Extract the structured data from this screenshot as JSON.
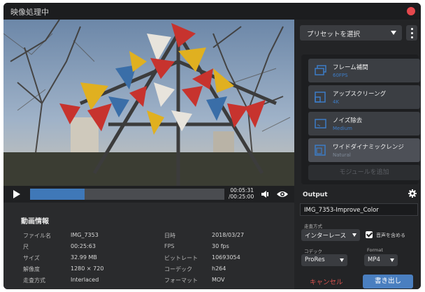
{
  "window": {
    "title": "映像処理中"
  },
  "player": {
    "progress": 0.28,
    "time_current": "00:05:31",
    "time_total": "/00:25:00"
  },
  "info": {
    "title": "動画情報",
    "rows_left": [
      {
        "label": "ファイル名",
        "value": "IMG_7353"
      },
      {
        "label": "尺",
        "value": "00:25:63"
      },
      {
        "label": "サイズ",
        "value": "32.99 MB"
      },
      {
        "label": "解像度",
        "value": "1280 × 720"
      },
      {
        "label": "走査方式",
        "value": "Interlaced"
      }
    ],
    "rows_right": [
      {
        "label": "日時",
        "value": "2018/03/27"
      },
      {
        "label": "FPS",
        "value": "30 fps"
      },
      {
        "label": "ビットレート",
        "value": "10693054"
      },
      {
        "label": "コーデック",
        "value": "h264"
      },
      {
        "label": "フォーマット",
        "value": "MOV"
      }
    ]
  },
  "panel": {
    "preset_label": "プリセットを選択",
    "modules": [
      {
        "name": "フレーム補間",
        "sub": "60FPS",
        "icon": "layers-icon"
      },
      {
        "name": "アップスクリーング",
        "sub": "4K",
        "icon": "expand-icon"
      },
      {
        "name": "ノイズ除去",
        "sub": "Medium",
        "icon": "noise-icon"
      },
      {
        "name": "ワイドダイナミックレンジ",
        "sub": "Natural",
        "icon": "hdr-icon"
      }
    ],
    "add_module_label": "モジュールを追加"
  },
  "output": {
    "title": "Output",
    "filename": "IMG_7353-Improve_Color",
    "scan_label": "走査方式",
    "scan_value": "インターレース",
    "audio_label": "音声を含める",
    "audio_checked": true,
    "codec_label": "コデック",
    "codec_value": "ProRes",
    "format_label": "Format",
    "format_value": "MP4",
    "cancel_label": "キャンセル",
    "export_label": "書き出し"
  },
  "colors": {
    "accent": "#4a7fc0",
    "close": "#e5484d",
    "cancel": "#d9534f"
  }
}
